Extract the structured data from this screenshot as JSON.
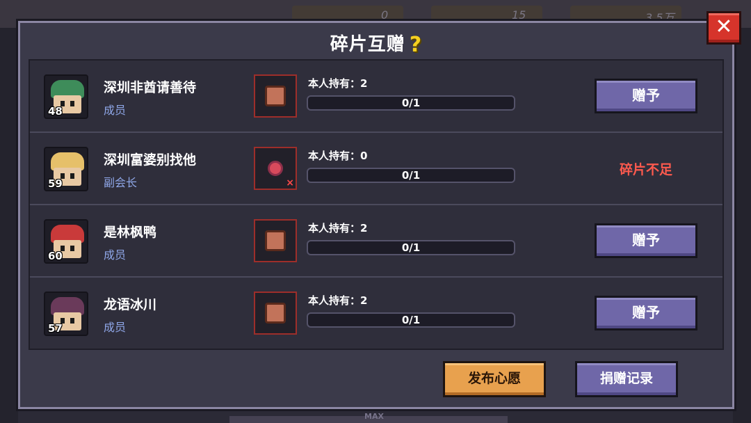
{
  "background": {
    "resources": [
      "0",
      "15",
      "3.5万"
    ],
    "max_label": "MAX"
  },
  "modal": {
    "title": "碎片互赠",
    "help_icon": "question-mark-icon",
    "close_icon": "close-x-icon"
  },
  "colors": {
    "accent_purple": "#6f67a8",
    "accent_orange": "#e8a14e",
    "warning_red": "#ff5a4e",
    "role_blue": "#8fa7e8"
  },
  "members": [
    {
      "name": "深圳非酋请善待",
      "role": "成员",
      "level": "48",
      "own": "本人持有：2",
      "progress": "0/1",
      "action": "赠予",
      "avatar_color": "#3e8c5a"
    },
    {
      "name": "深圳富婆别找他",
      "role": "副会长",
      "level": "59",
      "own": "本人持有：0",
      "progress": "0/1",
      "action": "碎片不足",
      "avatar_color": "#e6c06a"
    },
    {
      "name": "是林枫鸭",
      "role": "成员",
      "level": "60",
      "own": "本人持有：2",
      "progress": "0/1",
      "action": "赠予",
      "avatar_color": "#c93a3a"
    },
    {
      "name": "龙语冰川",
      "role": "成员",
      "level": "57",
      "own": "本人持有：2",
      "progress": "0/1",
      "action": "赠予",
      "avatar_color": "#6a3a5a"
    }
  ],
  "footer": {
    "publish_label": "发布心愿",
    "record_label": "捐赠记录"
  }
}
